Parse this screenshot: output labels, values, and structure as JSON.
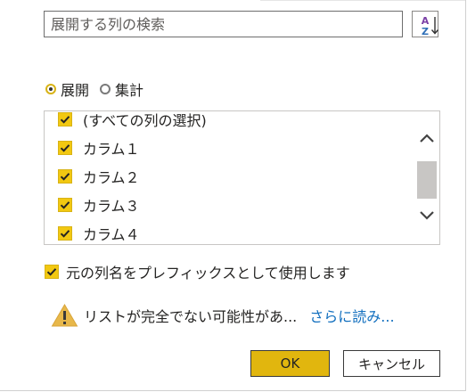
{
  "search": {
    "placeholder": "展開する列の検索",
    "value": ""
  },
  "sort_button": {
    "icon": "sort-az-icon",
    "top_glyph": "A",
    "bottom_glyph": "Z"
  },
  "mode": {
    "options": [
      {
        "label": "展開",
        "selected": true
      },
      {
        "label": "集計",
        "selected": false
      }
    ]
  },
  "columns": {
    "items": [
      {
        "label": "(すべての列の選択)",
        "checked": true
      },
      {
        "label": "カラム１",
        "checked": true
      },
      {
        "label": "カラム２",
        "checked": true
      },
      {
        "label": "カラム３",
        "checked": true
      },
      {
        "label": "カラム４",
        "checked": true
      }
    ]
  },
  "prefix_option": {
    "label": "元の列名をプレフィックスとして使用します",
    "checked": true
  },
  "warning": {
    "icon": "warning-icon",
    "text": "リストが完全でない可能性があ...",
    "link": "さらに読み..."
  },
  "actions": {
    "ok_label": "OK",
    "cancel_label": "キャンセル"
  },
  "colors": {
    "accent": "#f2c811",
    "ok_button": "#e1b60e",
    "link": "#106ebe",
    "warning": "#e8b84a"
  }
}
